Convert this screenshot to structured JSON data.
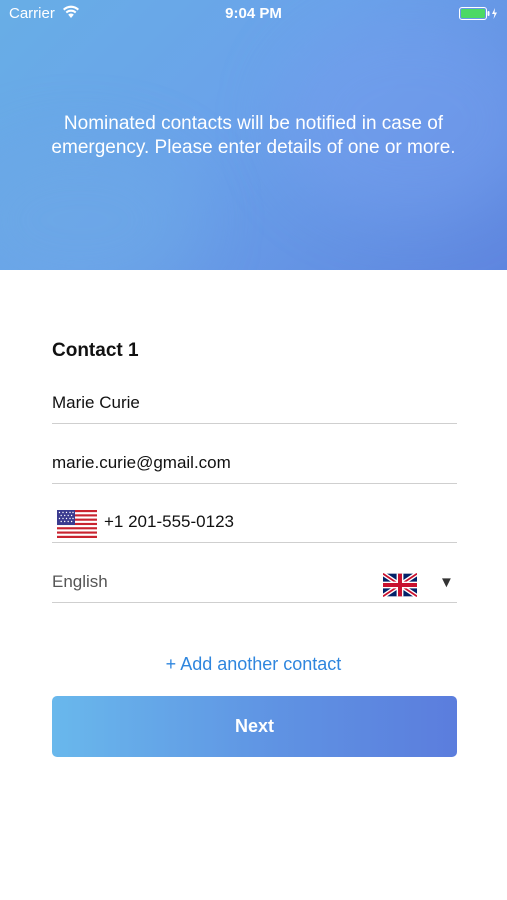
{
  "status_bar": {
    "carrier": "Carrier",
    "time": "9:04 PM",
    "wifi_icon": "wifi-icon",
    "battery_icon": "battery-icon",
    "battery_color": "#4cd964"
  },
  "header": {
    "message": "Nominated contacts will be notified in case of emergency. Please enter details of one or more.",
    "gradient_colors": [
      "#68aee6",
      "#5f86df"
    ]
  },
  "contact": {
    "title": "Contact 1",
    "name": "Marie Curie",
    "email": "marie.curie@gmail.com",
    "phone": {
      "country_flag": "us-flag-icon",
      "number": "+1 201-555-0123"
    },
    "language": {
      "value": "English",
      "flag": "uk-flag-icon",
      "dropdown_icon": "dropdown-arrow-icon"
    }
  },
  "actions": {
    "add_contact": "+ Add another contact",
    "next": "Next",
    "accent_color": "#2f86de"
  }
}
